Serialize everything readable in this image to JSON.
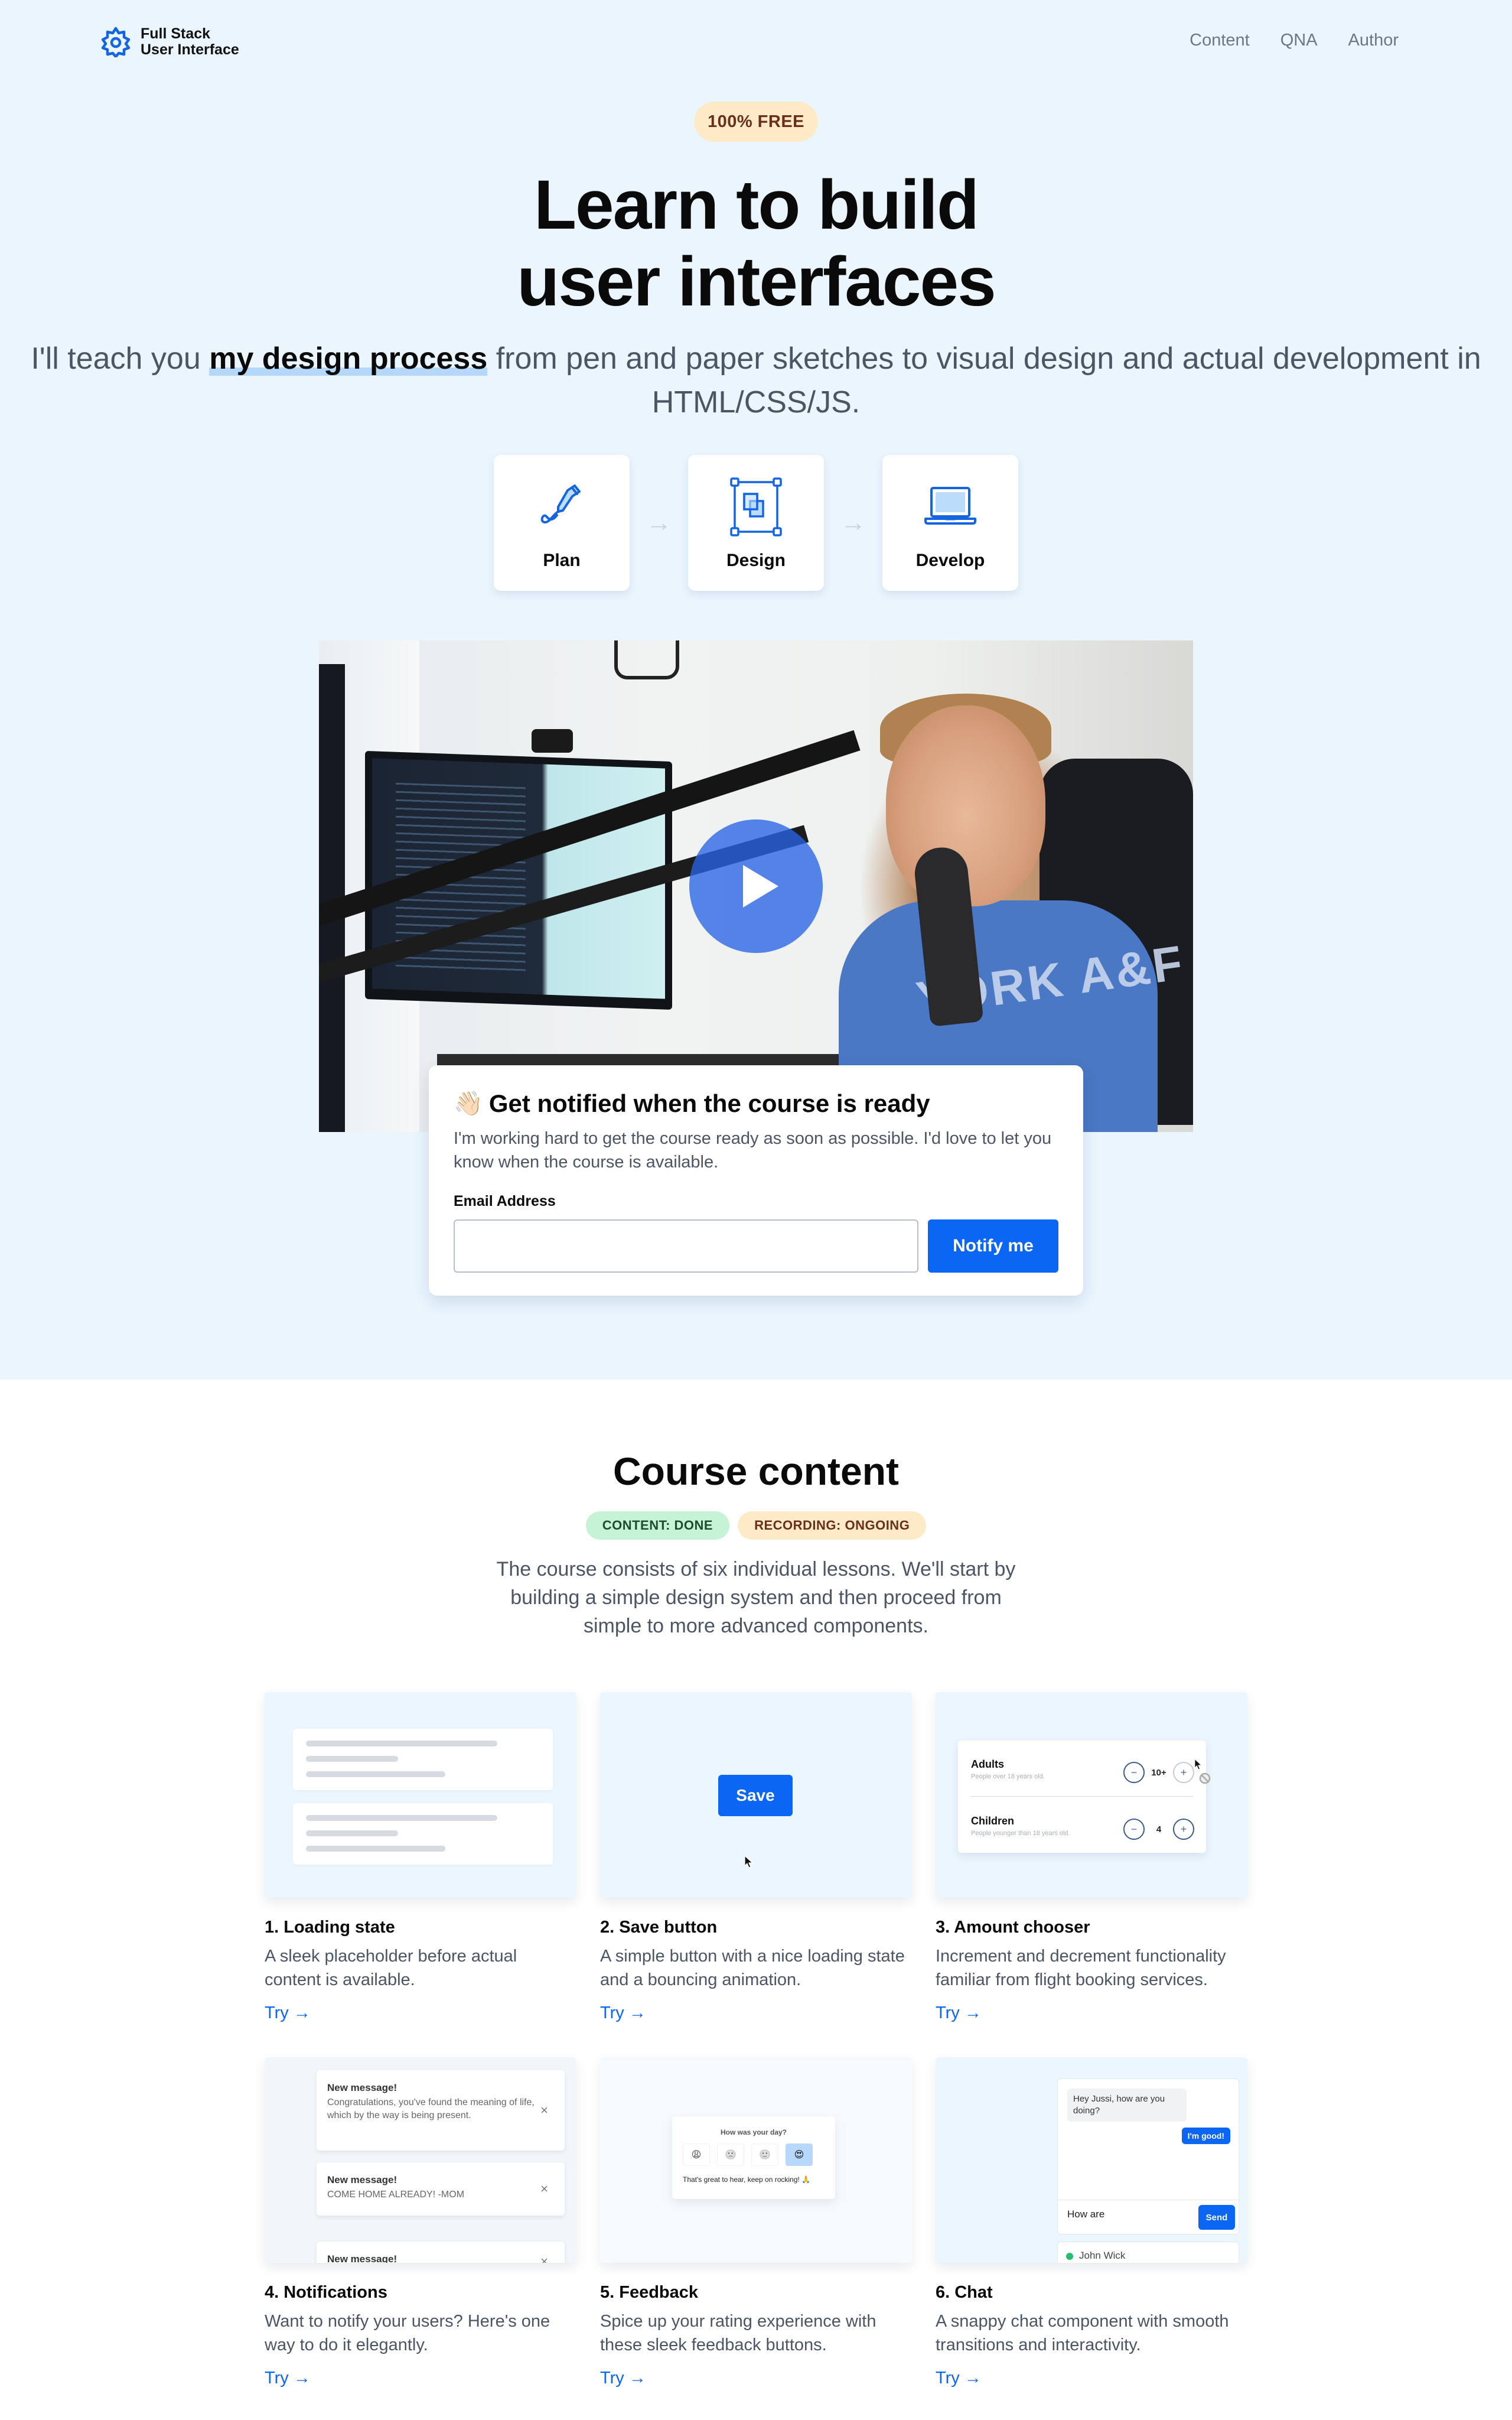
{
  "nav": {
    "logo_line1": "Full Stack",
    "logo_line2": "User Interface",
    "links": [
      "Content",
      "QNA",
      "Author"
    ]
  },
  "hero": {
    "badge": "100% FREE",
    "title": "Learn to build user interfaces",
    "subtitle_before": "I'll teach you ",
    "subtitle_highlight": "my design process",
    "subtitle_after": " from pen and paper sketches to visual design and actual development in HTML/CSS/JS.",
    "steps": [
      {
        "label": "Plan",
        "icon": "pen-icon"
      },
      {
        "label": "Design",
        "icon": "artboard-icon"
      },
      {
        "label": "Develop",
        "icon": "laptop-icon"
      }
    ],
    "step_arrow": "→",
    "video": {
      "play_icon": "play-icon",
      "shirt_text": "YORK A&F"
    }
  },
  "notify": {
    "emoji": "👋🏻",
    "title": "Get notified when the course is ready",
    "text": "I'm working hard to get the course ready as soon as possible. I'd love to let you know when the course is available.",
    "email_label": "Email Address",
    "email_value": "",
    "email_placeholder": "",
    "button": "Notify me"
  },
  "course": {
    "title": "Course content",
    "badges": [
      {
        "label": "CONTENT: DONE",
        "status": "done",
        "color": "#c6f3d6"
      },
      {
        "label": "RECORDING: ONGOING",
        "status": "ongoing",
        "color": "#fdebc8"
      }
    ],
    "description": "The course consists of six individual lessons. We'll start by building a simple design system and then proceed from simple to more advanced components.",
    "lessons": [
      {
        "name": "1. Loading state",
        "desc": "A sleek placeholder before actual content is available.",
        "try": "Try →"
      },
      {
        "name": "2. Save button",
        "desc": "A simple button with a nice loading state and a bouncing animation.",
        "try": "Try →"
      },
      {
        "name": "3. Amount chooser",
        "desc": "Increment and decrement functionality familiar from flight booking services.",
        "try": "Try →"
      },
      {
        "name": "4. Notifications",
        "desc": "Want to notify your users? Here's one way to do it elegantly.",
        "try": "Try →"
      },
      {
        "name": "5. Feedback",
        "desc": "Spice up your rating experience with these sleek feedback buttons.",
        "try": "Try →"
      },
      {
        "name": "6. Chat",
        "desc": "A snappy chat component with smooth transitions and interactivity.",
        "try": "Try →"
      }
    ],
    "previews": {
      "save": {
        "button": "Save"
      },
      "amount": {
        "rows": [
          {
            "name": "Adults",
            "hint": "People over 18 years old.",
            "value": "10+",
            "minus": "−",
            "plus": "+"
          },
          {
            "name": "Children",
            "hint": "People younger than 18 years old.",
            "value": "4",
            "minus": "−",
            "plus": "+"
          }
        ]
      },
      "notifications": [
        {
          "title": "New message!",
          "body": "Congratulations, you've found the meaning of life, which by the way is being present.",
          "close": "×"
        },
        {
          "title": "New message!",
          "body": "COME HOME ALREADY! -MOM",
          "close": "×"
        },
        {
          "title": "New message!",
          "body": "",
          "close": "×"
        }
      ],
      "feedback": {
        "question": "How was your day?",
        "options": [
          "😩",
          "🙁",
          "🙂",
          "😍"
        ],
        "selected_index": 3,
        "message": "That's great to hear, keep on rocking! 🙏"
      },
      "chat": {
        "incoming": "Hey Jussi, how are you doing?",
        "outgoing": "I'm good!",
        "input_value": "How are ",
        "send": "Send",
        "contact": "John Wick",
        "contact_status_color": "#22c06e"
      }
    }
  },
  "colors": {
    "accent": "#0a66f3",
    "hero_bg": "#eaf5fe",
    "badge_warm_bg": "#fdebc8",
    "badge_warm_text": "#6b2f17",
    "badge_green_bg": "#c6f3d6",
    "badge_green_text": "#1d4d2f"
  }
}
